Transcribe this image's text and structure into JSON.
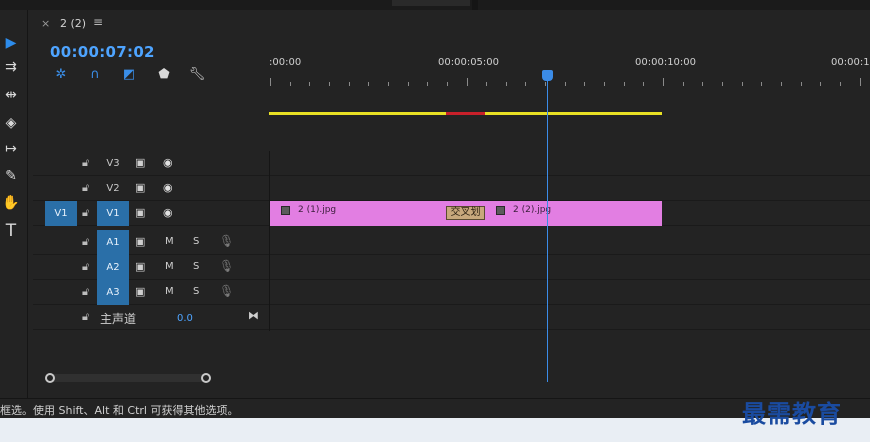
{
  "sequence_tab": {
    "close": "×",
    "title": "2 (2)",
    "menu": "≡"
  },
  "timecode": "00:00:07:02",
  "toolbar_icons": [
    "snap-nest-icon",
    "magnet-icon",
    "linked-selection-icon",
    "marker-icon",
    "wrench-icon"
  ],
  "tools": [
    "selection-tool",
    "track-select-tool",
    "ripple-edit-tool",
    "razor-tool",
    "slip-tool",
    "pen-tool",
    "hand-tool",
    "type-tool"
  ],
  "ruler": {
    "labels": [
      ":00:00",
      "00:00:05:00",
      "00:00:10:00",
      "00:00:15"
    ]
  },
  "video_tracks": [
    {
      "target": "V3",
      "source": ""
    },
    {
      "target": "V2",
      "source": ""
    },
    {
      "target": "V1",
      "source": "V1"
    }
  ],
  "audio_tracks": [
    {
      "target": "A1",
      "m": "M",
      "s": "S"
    },
    {
      "target": "A2",
      "m": "M",
      "s": "S"
    },
    {
      "target": "A3",
      "m": "M",
      "s": "S"
    }
  ],
  "master": {
    "label": "主声道",
    "value": "0.0"
  },
  "clips": {
    "clip1": "2 (1).jpg",
    "transition": "交叉划",
    "clip2": "2 (2).jpg"
  },
  "status_text": "框选。使用 Shift、Alt 和 Ctrl 可获得其他选项。",
  "watermark": "最需教育",
  "colors": {
    "accent": "#4ea4ff",
    "clip": "#e27ee2",
    "workarea": "#e8e024",
    "target_on": "#2a6fa8"
  }
}
